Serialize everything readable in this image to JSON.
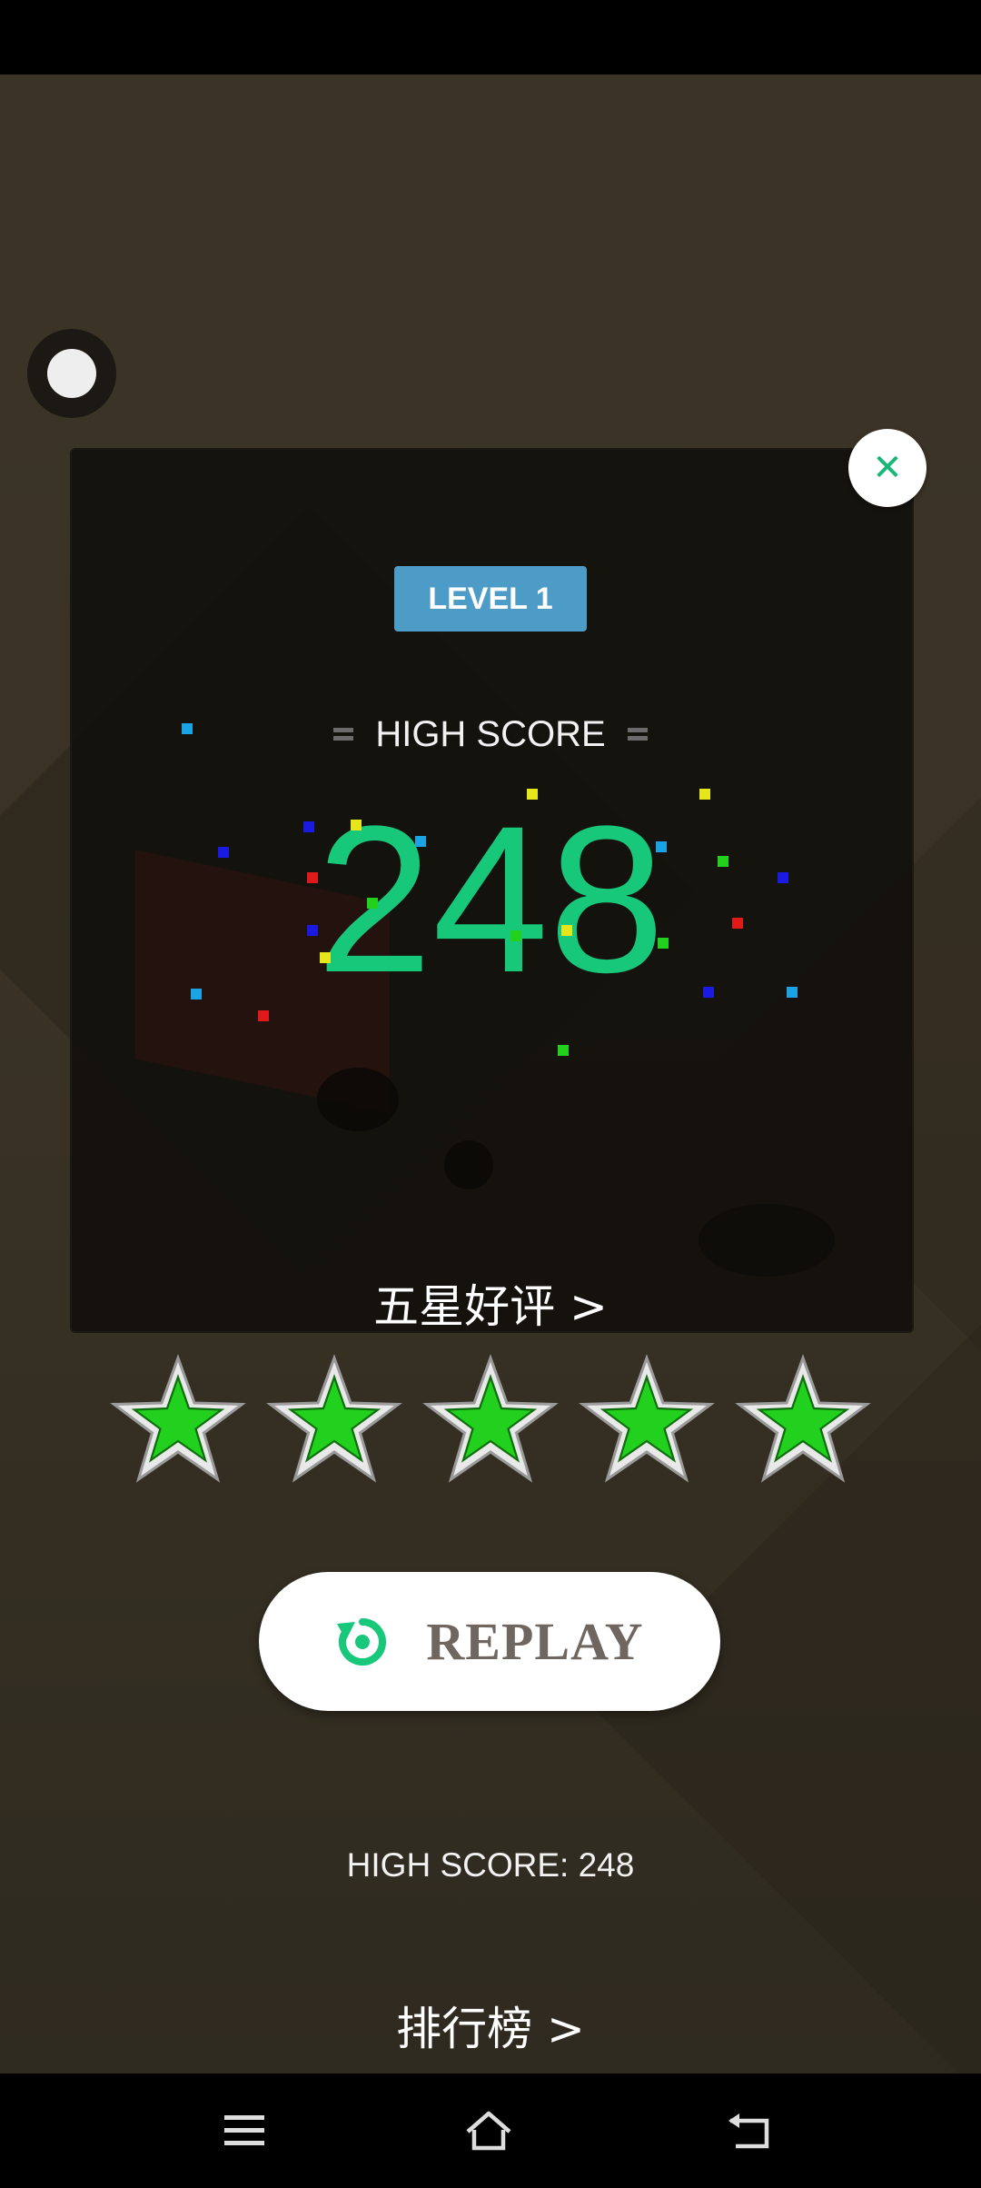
{
  "level_badge": "LEVEL 1",
  "result_panel": {
    "high_score_title": "HIGH SCORE",
    "score": "248"
  },
  "rate_link": "五星好评 >",
  "rating": {
    "stars": 5,
    "max_stars": 5
  },
  "replay_button": {
    "label": "REPLAY",
    "icon": "replay-icon"
  },
  "high_score_line": "HIGH SCORE: 248",
  "leaderboard_link": "排行榜 >",
  "nav_bar": {
    "icons": [
      "menu-icon",
      "home-icon",
      "back-icon"
    ]
  },
  "colors": {
    "score_green": "#17c77a",
    "badge_blue": "#4d9bc7",
    "star_green": "#22d11e",
    "close_x": "#17b679"
  }
}
